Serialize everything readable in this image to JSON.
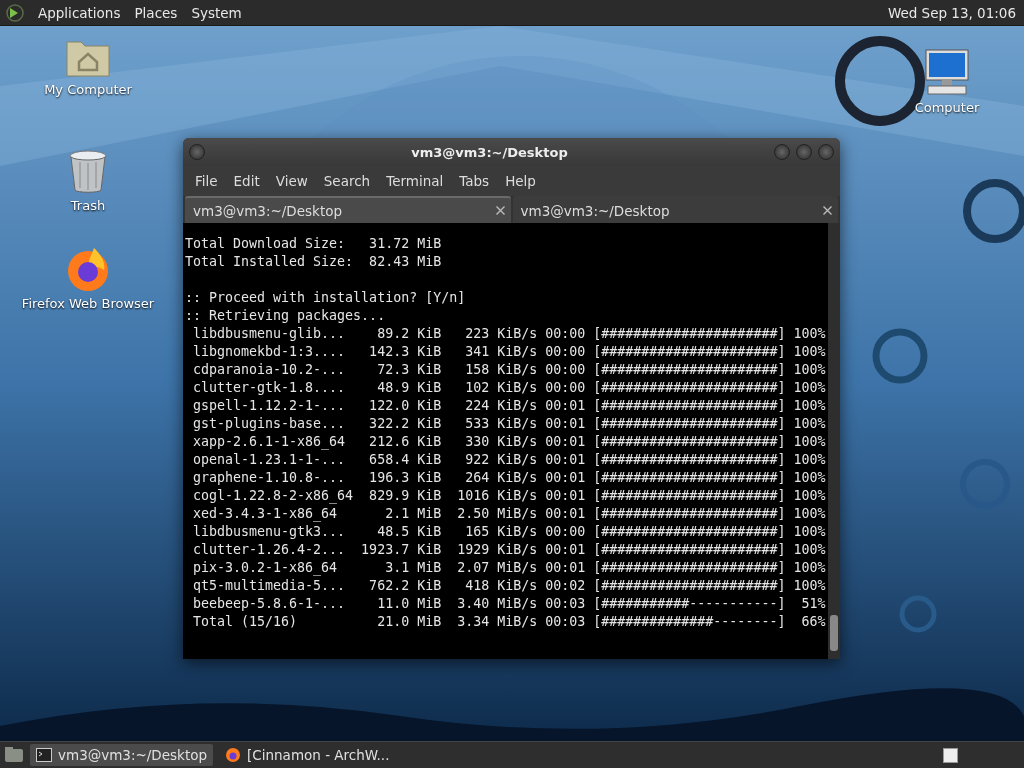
{
  "top_panel": {
    "menus": [
      "Applications",
      "Places",
      "System"
    ],
    "clock": "Wed Sep 13, 01:06"
  },
  "desktop_icons": [
    {
      "label": "My Computer",
      "kind": "home-folder"
    },
    {
      "label": "Trash",
      "kind": "trash"
    },
    {
      "label": "Firefox Web Browser",
      "kind": "browser"
    },
    {
      "label": "Computer",
      "kind": "monitor"
    }
  ],
  "terminal": {
    "title": "vm3@vm3:~/Desktop",
    "menu": [
      "File",
      "Edit",
      "View",
      "Search",
      "Terminal",
      "Tabs",
      "Help"
    ],
    "tabs": [
      {
        "label": "vm3@vm3:~/Desktop",
        "selected": true
      },
      {
        "label": "vm3@vm3:~/Desktop",
        "selected": false
      }
    ],
    "output_blocks": [
      {
        "lines": [
          "Total Download Size:   31.72 MiB",
          "Total Installed Size:  82.43 MiB"
        ]
      },
      {
        "lines": [
          ":: Proceed with installation? [Y/n]",
          ":: Retrieving packages...",
          " libdbusmenu-glib...    89.2 KiB   223 KiB/s 00:00 [######################] 100%",
          " libgnomekbd-1:3....   142.3 KiB   341 KiB/s 00:00 [######################] 100%",
          " cdparanoia-10.2-...    72.3 KiB   158 KiB/s 00:00 [######################] 100%",
          " clutter-gtk-1.8....    48.9 KiB   102 KiB/s 00:00 [######################] 100%",
          " gspell-1.12.2-1-...   122.0 KiB   224 KiB/s 00:01 [######################] 100%",
          " gst-plugins-base...   322.2 KiB   533 KiB/s 00:01 [######################] 100%",
          " xapp-2.6.1-1-x86_64   212.6 KiB   330 KiB/s 00:01 [######################] 100%",
          " openal-1.23.1-1-...   658.4 KiB   922 KiB/s 00:01 [######################] 100%",
          " graphene-1.10.8-...   196.3 KiB   264 KiB/s 00:01 [######################] 100%",
          " cogl-1.22.8-2-x86_64  829.9 KiB  1016 KiB/s 00:01 [######################] 100%",
          " xed-3.4.3-1-x86_64      2.1 MiB  2.50 MiB/s 00:01 [######################] 100%",
          " libdbusmenu-gtk3...    48.5 KiB   165 KiB/s 00:00 [######################] 100%",
          " clutter-1.26.4-2...  1923.7 KiB  1929 KiB/s 00:01 [######################] 100%",
          " pix-3.0.2-1-x86_64      3.1 MiB  2.07 MiB/s 00:01 [######################] 100%",
          " qt5-multimedia-5...   762.2 KiB   418 KiB/s 00:02 [######################] 100%",
          " beebeep-5.8.6-1-...    11.0 MiB  3.40 MiB/s 00:03 [###########-----------]  51%",
          " Total (15/16)          21.0 MiB  3.34 MiB/s 00:03 [##############--------]  66%"
        ]
      }
    ]
  },
  "taskbar": {
    "tasks": [
      {
        "label": "vm3@vm3:~/Desktop",
        "kind": "terminal",
        "selected": true
      },
      {
        "label": "[Cinnamon - ArchW...",
        "kind": "browser",
        "selected": false
      }
    ]
  }
}
